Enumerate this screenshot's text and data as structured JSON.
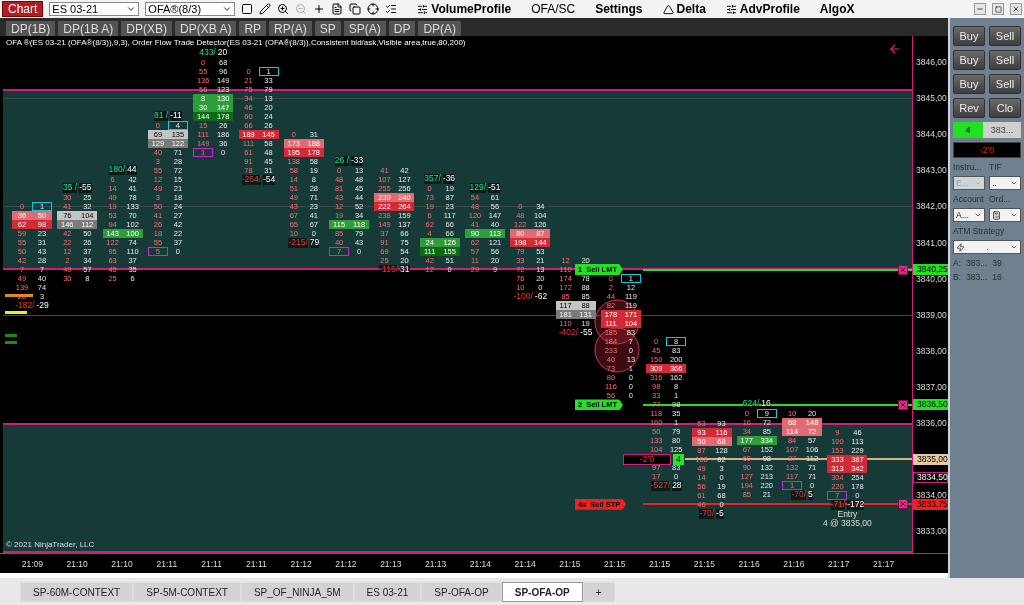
{
  "toolbar": {
    "chart_button": "Chart",
    "instrument": "ES 03-21",
    "indicator": "OFA®(8/3)",
    "links": [
      {
        "label": "VolumeProfile",
        "kind": "sliders"
      },
      {
        "label": "OFA/SC",
        "kind": "plain"
      },
      {
        "label": "Settings",
        "kind": "plain"
      },
      {
        "label": "Delta",
        "kind": "triangle"
      },
      {
        "label": "AdvProfile",
        "kind": "sliders"
      },
      {
        "label": "AlgoX",
        "kind": "plain"
      }
    ]
  },
  "chart_tabs": [
    "DP(1B)",
    "DP(1B A)",
    "DP(XB)",
    "DP(XB A)",
    "RP",
    "RP(A)",
    "SP",
    "SP(A)",
    "DP",
    "DP(A)"
  ],
  "indicator_text": "OFA ®(ES 03-21 (OFA®(8/3)),9,3), Order Flow Trade Detector(ES 03-21 (OFA®(8/3)),Consistent bid/ask,Visible area,true,80,200)",
  "columns": [
    {
      "footer": [
        "-182/",
        "-29"
      ],
      "rows": [
        {
          "b": "0",
          "a": "1",
          "ask_boxed": true
        },
        {
          "b": "36",
          "a": "50",
          "kind": "sell"
        },
        {
          "b": "62",
          "a": "98",
          "kind": "sell2"
        },
        {
          "b": "59",
          "a": "23"
        },
        {
          "b": "55",
          "a": "31"
        },
        {
          "b": "50",
          "a": "43"
        },
        {
          "b": "42",
          "a": "28"
        },
        {
          "b": "7",
          "a": "7"
        },
        {
          "b": "49",
          "a": "40"
        },
        {
          "b": "139",
          "a": "74"
        },
        {
          "b": "20",
          "a": "3"
        }
      ]
    },
    {
      "header": [
        "35 /",
        "-55"
      ],
      "rows": [
        {
          "b": "30",
          "a": "25"
        },
        {
          "b": "41",
          "a": "32"
        },
        {
          "b": "76",
          "a": "104",
          "kind": "neutral"
        },
        {
          "b": "146",
          "a": "112",
          "kind": "neutral2"
        },
        {
          "b": "42",
          "a": "50"
        },
        {
          "b": "22",
          "a": "26"
        },
        {
          "b": "12",
          "a": "37"
        },
        {
          "b": "2",
          "a": "34"
        },
        {
          "b": "49",
          "a": "57"
        },
        {
          "b": "30",
          "a": "8"
        }
      ]
    },
    {
      "header": [
        "180/",
        "44"
      ],
      "rows": [
        {
          "b": "6",
          "a": "42"
        },
        {
          "b": "14",
          "a": "41"
        },
        {
          "b": "49",
          "a": "78"
        },
        {
          "b": "19",
          "a": "133"
        },
        {
          "b": "53",
          "a": "70"
        },
        {
          "b": "94",
          "a": "102"
        },
        {
          "b": "143",
          "a": "100",
          "kind": "buy"
        },
        {
          "b": "122",
          "a": "74"
        },
        {
          "b": "95",
          "a": "110"
        },
        {
          "b": "63",
          "a": "37"
        },
        {
          "b": "45",
          "a": "35"
        },
        {
          "b": "25",
          "a": "6"
        }
      ]
    },
    {
      "header": [
        "81 /",
        "-11"
      ],
      "rows": [
        {
          "b": "0",
          "a": "4",
          "ask_boxed": true
        },
        {
          "b": "69",
          "a": "135",
          "kind": "neutral"
        },
        {
          "b": "129",
          "a": "122",
          "kind": "neutral2"
        },
        {
          "b": "40",
          "a": "71"
        },
        {
          "b": "3",
          "a": "28"
        },
        {
          "b": "55",
          "a": "72"
        },
        {
          "b": "12",
          "a": "15"
        },
        {
          "b": "49",
          "a": "21"
        },
        {
          "b": "3",
          "a": "18"
        },
        {
          "b": "50",
          "a": "24"
        },
        {
          "b": "41",
          "a": "27"
        },
        {
          "b": "26",
          "a": "42"
        },
        {
          "b": "18",
          "a": "22"
        },
        {
          "b": "55",
          "a": "37"
        },
        {
          "b": "5",
          "a": "0",
          "bid_boxed": true
        }
      ]
    },
    {
      "header": [
        "433/",
        "20"
      ],
      "rows": [
        {
          "b": "0",
          "a": "68"
        },
        {
          "b": "55",
          "a": "96"
        },
        {
          "b": "136",
          "a": "149"
        },
        {
          "b": "56",
          "a": "123"
        },
        {
          "b": "8",
          "a": "130",
          "kind": "buy"
        },
        {
          "b": "30",
          "a": "147",
          "kind": "buy"
        },
        {
          "b": "144",
          "a": "178",
          "kind": "buy2"
        },
        {
          "b": "15",
          "a": "26"
        },
        {
          "b": "111",
          "a": "186"
        },
        {
          "b": "149",
          "a": "36"
        },
        {
          "b": "1",
          "a": "0",
          "bid_boxed": true
        }
      ]
    },
    {
      "footer": [
        "-264/",
        "-54"
      ],
      "rows": [
        {
          "b": "0",
          "a": "1",
          "ask_boxed": true
        },
        {
          "b": "21",
          "a": "33"
        },
        {
          "b": "75",
          "a": "79"
        },
        {
          "b": "34",
          "a": "13"
        },
        {
          "b": "46",
          "a": "20"
        },
        {
          "b": "60",
          "a": "24"
        },
        {
          "b": "66",
          "a": "26"
        },
        {
          "b": "189",
          "a": "145",
          "kind": "sell2"
        },
        {
          "b": "111",
          "a": "58"
        },
        {
          "b": "61",
          "a": "48"
        },
        {
          "b": "91",
          "a": "45"
        },
        {
          "b": "78",
          "a": "31"
        }
      ]
    },
    {
      "footer": [
        "-215/",
        "79"
      ],
      "rows": [
        {
          "b": "0",
          "a": "31"
        },
        {
          "b": "173",
          "a": "188",
          "kind": "sell"
        },
        {
          "b": "195",
          "a": "178",
          "kind": "sell2"
        },
        {
          "b": "138",
          "a": "58"
        },
        {
          "b": "58",
          "a": "19"
        },
        {
          "b": "14",
          "a": "8"
        },
        {
          "b": "51",
          "a": "28"
        },
        {
          "b": "49",
          "a": "71"
        },
        {
          "b": "43",
          "a": "23"
        },
        {
          "b": "67",
          "a": "41"
        },
        {
          "b": "65",
          "a": "67"
        },
        {
          "b": "10",
          "a": "0"
        }
      ]
    },
    {
      "header": [
        "26 /",
        "-33"
      ],
      "rows": [
        {
          "b": "0",
          "a": "13"
        },
        {
          "b": "48",
          "a": "48"
        },
        {
          "b": "81",
          "a": "45"
        },
        {
          "b": "43",
          "a": "44"
        },
        {
          "b": "12",
          "a": "52"
        },
        {
          "b": "19",
          "a": "34"
        },
        {
          "b": "115",
          "a": "118",
          "kind": "buy"
        },
        {
          "b": "85",
          "a": "79"
        },
        {
          "b": "40",
          "a": "43"
        },
        {
          "b": "7",
          "a": "0",
          "bid_boxed": true
        }
      ]
    },
    {
      "footer": [
        "-116/",
        "31"
      ],
      "rows": [
        {
          "b": "41",
          "a": "42"
        },
        {
          "b": "107",
          "a": "127"
        },
        {
          "b": "255",
          "a": "256"
        },
        {
          "b": "230",
          "a": "240",
          "kind": "sell"
        },
        {
          "b": "222",
          "a": "264",
          "kind": "sell2"
        },
        {
          "b": "238",
          "a": "159"
        },
        {
          "b": "149",
          "a": "137"
        },
        {
          "b": "37",
          "a": "66"
        },
        {
          "b": "91",
          "a": "75"
        },
        {
          "b": "69",
          "a": "54"
        },
        {
          "b": "25",
          "a": "20"
        }
      ]
    },
    {
      "header": [
        "357/",
        "-36"
      ],
      "rows": [
        {
          "b": "0",
          "a": "19"
        },
        {
          "b": "73",
          "a": "87"
        },
        {
          "b": "19",
          "a": "23"
        },
        {
          "b": "6",
          "a": "117"
        },
        {
          "b": "62",
          "a": "66"
        },
        {
          "b": "4",
          "a": "66"
        },
        {
          "b": "24",
          "a": "126",
          "kind": "buy"
        },
        {
          "b": "111",
          "a": "155",
          "kind": "buy2"
        },
        {
          "b": "42",
          "a": "51"
        },
        {
          "b": "12",
          "a": "0"
        }
      ]
    },
    {
      "header": [
        "129/",
        "-51"
      ],
      "rows": [
        {
          "b": "54",
          "a": "61"
        },
        {
          "b": "48",
          "a": "56"
        },
        {
          "b": "120",
          "a": "147"
        },
        {
          "b": "41",
          "a": "40"
        },
        {
          "b": "90",
          "a": "113",
          "kind": "buy"
        },
        {
          "b": "62",
          "a": "121"
        },
        {
          "b": "57",
          "a": "56"
        },
        {
          "b": "11",
          "a": "20"
        },
        {
          "b": "29",
          "a": "9"
        }
      ]
    },
    {
      "footer": [
        "-100/",
        "-62"
      ],
      "rows": [
        {
          "b": "0",
          "a": "34"
        },
        {
          "b": "48",
          "a": "104"
        },
        {
          "b": "122",
          "a": "126"
        },
        {
          "b": "80",
          "a": "87",
          "kind": "sell"
        },
        {
          "b": "198",
          "a": "144",
          "kind": "sell2"
        },
        {
          "b": "79",
          "a": "53"
        },
        {
          "b": "33",
          "a": "21"
        },
        {
          "b": "72",
          "a": "13"
        },
        {
          "b": "76",
          "a": "20"
        },
        {
          "b": "10",
          "a": "0"
        }
      ]
    },
    {
      "footer": [
        "-402/",
        "-55"
      ],
      "rows": [
        {
          "b": "12",
          "a": "20"
        },
        {
          "b": "110"
        },
        {
          "b": "174",
          "a": "78"
        },
        {
          "b": "172",
          "a": "88"
        },
        {
          "b": "85",
          "a": "85"
        },
        {
          "b": "117",
          "a": "88",
          "kind": "neutral"
        },
        {
          "b": "181",
          "a": "131",
          "kind": "neutral2"
        },
        {
          "b": "110",
          "a": "19"
        }
      ]
    },
    {
      "rows": [
        {
          "b": "0",
          "a": "1",
          "ask_boxed": true
        },
        {
          "b": "2",
          "a": "12"
        },
        {
          "b": "44",
          "a": "119"
        },
        {
          "b": "82",
          "a": "119"
        },
        {
          "b": "178",
          "a": "171",
          "kind": "sell2"
        },
        {
          "b": "111",
          "a": "104",
          "kind": "sell2"
        },
        {
          "b": "185",
          "a": "83"
        },
        {
          "b": "184",
          "a": "7"
        },
        {
          "b": "233",
          "a": "0"
        },
        {
          "b": "40",
          "a": "13"
        },
        {
          "b": "73",
          "a": "1"
        },
        {
          "b": "80",
          "a": "0"
        },
        {
          "b": "116",
          "a": "0"
        },
        {
          "b": "56",
          "a": "0"
        }
      ]
    },
    {
      "footer": [
        "-527/",
        "28"
      ],
      "rows": [
        {
          "b": "0",
          "a": "8",
          "ask_boxed": true
        },
        {
          "b": "45",
          "a": "83"
        },
        {
          "b": "150",
          "a": "200"
        },
        {
          "b": "309",
          "a": "366",
          "kind": "sell2"
        },
        {
          "b": "316",
          "a": "162"
        },
        {
          "b": "98",
          "a": "8"
        },
        {
          "b": "33",
          "a": "1"
        },
        {
          "b": "77",
          "a": "98"
        },
        {
          "b": "118",
          "a": "35"
        },
        {
          "b": "160",
          "a": "1"
        },
        {
          "b": "50",
          "a": "79"
        },
        {
          "b": "133",
          "a": "80"
        },
        {
          "b": "104",
          "a": "125"
        },
        {},
        {
          "b": "97",
          "a": "83"
        },
        {
          "b": "17",
          "a": "0"
        }
      ]
    },
    {
      "footer": [
        "-70/",
        "-5"
      ],
      "rows": [
        {
          "b": "53",
          "a": "93"
        },
        {
          "b": "93",
          "a": "116",
          "kind": "sell2"
        },
        {
          "b": "50",
          "a": "68",
          "kind": "sell"
        },
        {
          "b": "87",
          "a": "128"
        },
        {
          "b": "108",
          "a": "62"
        },
        {
          "b": "49",
          "a": "3"
        },
        {
          "b": "14",
          "a": "0"
        },
        {
          "b": "56",
          "a": "19"
        },
        {
          "b": "61",
          "a": "68"
        },
        {
          "b": "46",
          "a": "0"
        }
      ]
    },
    {
      "header": [
        "624/",
        "16"
      ],
      "rows": [
        {
          "b": "0",
          "a": "9",
          "ask_boxed": true
        },
        {
          "b": "16",
          "a": "72"
        },
        {
          "b": "34",
          "a": "85"
        },
        {
          "b": "177",
          "a": "334",
          "kind": "buy"
        },
        {
          "b": "67",
          "a": "152"
        },
        {
          "b": "60",
          "a": "98"
        },
        {
          "b": "90",
          "a": "132"
        },
        {
          "b": "127",
          "a": "213"
        },
        {
          "b": "194",
          "a": "220"
        },
        {
          "b": "85",
          "a": "21"
        }
      ]
    },
    {
      "footer": [
        "-70/",
        "5"
      ],
      "rows": [
        {
          "b": "10",
          "a": "20"
        },
        {
          "b": "68",
          "a": "148",
          "kind": "sell"
        },
        {
          "b": "114",
          "a": "72",
          "kind": "sell"
        },
        {
          "b": "84",
          "a": "57"
        },
        {
          "b": "107",
          "a": "106"
        },
        {
          "b": "87",
          "a": "112"
        },
        {
          "b": "132",
          "a": "71"
        },
        {
          "b": "117",
          "a": "71"
        },
        {
          "b": "1",
          "a": "0",
          "bid_boxed": true
        }
      ]
    },
    {
      "footer": [
        "-71/",
        "-172"
      ],
      "notes": [
        "Entry",
        "4 @ 3835,00"
      ],
      "rows": [
        {
          "b": "9",
          "a": "46"
        },
        {
          "b": "100",
          "a": "113"
        },
        {
          "b": "153",
          "a": "229"
        },
        {
          "b": "333",
          "a": "387",
          "kind": "sell2"
        },
        {
          "b": "313",
          "a": "342",
          "kind": "sell2"
        },
        {
          "b": "304",
          "a": "254"
        },
        {
          "b": "220",
          "a": "178"
        },
        {
          "b": "7",
          "a": "0",
          "bid_boxed": true
        }
      ]
    }
  ],
  "orders": [
    {
      "kind": "limit",
      "qty": "1",
      "label": "Sell LMT",
      "price": "3840,25"
    },
    {
      "kind": "limit",
      "qty": "2",
      "label": "Sell LMT",
      "price": "3836,50"
    },
    {
      "kind": "stop",
      "qty": "4s",
      "label": "Sell STP",
      "price": "3833,75"
    }
  ],
  "position": {
    "pnl": "-2'0",
    "qty": "4",
    "price": "3835,00"
  },
  "last_price": "3834,50",
  "price_labels": [
    "3846,00",
    "3845,00",
    "3844,00",
    "3843,00",
    "3842,00",
    "3841,00",
    "3840,00",
    "3839,00",
    "3838,00",
    "3837,00",
    "3836,00",
    "3834,00",
    "3833,00"
  ],
  "copyright": "© 2021 NinjaTrader, LLC",
  "time_labels": [
    "21:09",
    "21:10",
    "21:10",
    "21:11",
    "21:11",
    "21:11",
    "21:12",
    "21:12",
    "21:13",
    "21:13",
    "21:14",
    "21:14",
    "21:15",
    "21:15",
    "21:15",
    "21:15",
    "21:16",
    "21:16",
    "21:17",
    "21:17"
  ],
  "panel": {
    "buttons": [
      [
        "Buy",
        "Sell"
      ],
      [
        "Buy",
        "Sell"
      ],
      [
        "Buy",
        "Sell"
      ],
      [
        "Rev",
        "Clo"
      ]
    ],
    "position_qty": "4",
    "position_price": "383...",
    "pnl": "-2'0",
    "instrument_label": "Instru...",
    "tif_label": "TIF",
    "instrument_value": "E...",
    "tif_value": "..",
    "account_label": "Account",
    "order_label": "Ord...",
    "account_value": "A...",
    "atm_label": "ATM Strategy",
    "atm_value": ".",
    "quotes": [
      [
        "A:",
        "383...",
        "39"
      ],
      [
        "B:",
        "383...",
        "16"
      ]
    ]
  },
  "sheet_tabs": [
    {
      "label": "SP-60M-CONTEXT",
      "selected": false
    },
    {
      "label": "SP-5M-CONTEXT",
      "selected": false
    },
    {
      "label": "SP_OF_NINJA_5M",
      "selected": false
    },
    {
      "label": "ES 03-21",
      "selected": false
    },
    {
      "label": "SP-OFA-OP",
      "selected": false
    },
    {
      "label": "SP-OFA-OP",
      "selected": true
    }
  ],
  "add_tab": "+"
}
